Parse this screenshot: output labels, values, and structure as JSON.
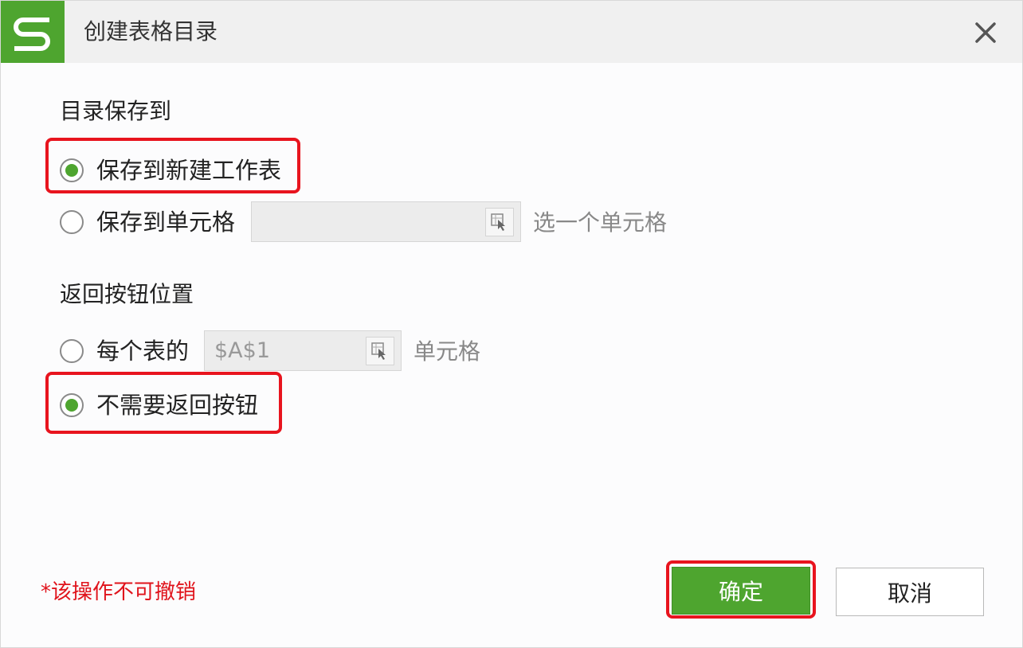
{
  "dialog": {
    "title": "创建表格目录",
    "close_icon": "close-icon",
    "logo_icon": "wps-spreadsheet-logo-icon"
  },
  "save_to": {
    "section_label": "目录保存到",
    "option_new_sheet": "保存到新建工作表",
    "option_cell": "保存到单元格",
    "cell_value": "",
    "cell_hint": "选一个单元格",
    "selected": "new_sheet"
  },
  "return_button": {
    "section_label": "返回按钮位置",
    "option_each_sheet": "每个表的",
    "cell_value": "$A$1",
    "cell_suffix": "单元格",
    "option_none": "不需要返回按钮",
    "selected": "none"
  },
  "footer": {
    "warning": "*该操作不可撤销",
    "ok_label": "确定",
    "cancel_label": "取消"
  },
  "colors": {
    "accent_green": "#4ea52f",
    "highlight_red": "#e8141e",
    "warning_red": "#e0141c"
  }
}
